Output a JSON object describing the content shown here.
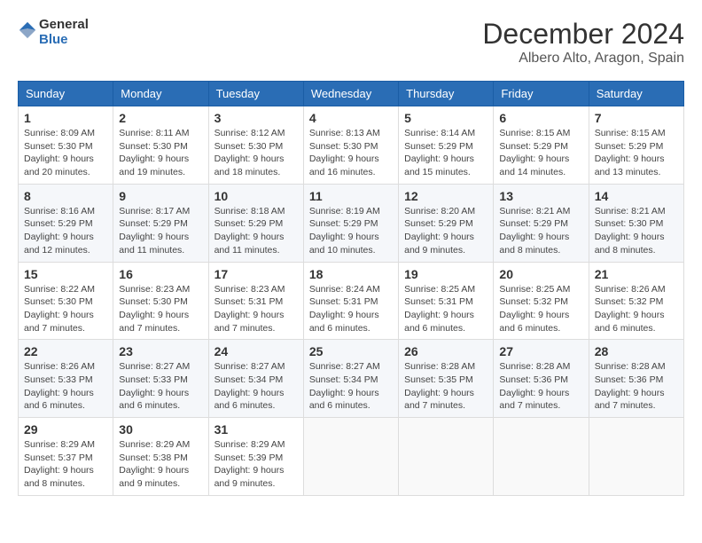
{
  "header": {
    "logo_general": "General",
    "logo_blue": "Blue",
    "month_title": "December 2024",
    "subtitle": "Albero Alto, Aragon, Spain"
  },
  "weekdays": [
    "Sunday",
    "Monday",
    "Tuesday",
    "Wednesday",
    "Thursday",
    "Friday",
    "Saturday"
  ],
  "weeks": [
    [
      {
        "day": "1",
        "info": "Sunrise: 8:09 AM\nSunset: 5:30 PM\nDaylight: 9 hours and 20 minutes."
      },
      {
        "day": "2",
        "info": "Sunrise: 8:11 AM\nSunset: 5:30 PM\nDaylight: 9 hours and 19 minutes."
      },
      {
        "day": "3",
        "info": "Sunrise: 8:12 AM\nSunset: 5:30 PM\nDaylight: 9 hours and 18 minutes."
      },
      {
        "day": "4",
        "info": "Sunrise: 8:13 AM\nSunset: 5:30 PM\nDaylight: 9 hours and 16 minutes."
      },
      {
        "day": "5",
        "info": "Sunrise: 8:14 AM\nSunset: 5:29 PM\nDaylight: 9 hours and 15 minutes."
      },
      {
        "day": "6",
        "info": "Sunrise: 8:15 AM\nSunset: 5:29 PM\nDaylight: 9 hours and 14 minutes."
      },
      {
        "day": "7",
        "info": "Sunrise: 8:15 AM\nSunset: 5:29 PM\nDaylight: 9 hours and 13 minutes."
      }
    ],
    [
      {
        "day": "8",
        "info": "Sunrise: 8:16 AM\nSunset: 5:29 PM\nDaylight: 9 hours and 12 minutes."
      },
      {
        "day": "9",
        "info": "Sunrise: 8:17 AM\nSunset: 5:29 PM\nDaylight: 9 hours and 11 minutes."
      },
      {
        "day": "10",
        "info": "Sunrise: 8:18 AM\nSunset: 5:29 PM\nDaylight: 9 hours and 11 minutes."
      },
      {
        "day": "11",
        "info": "Sunrise: 8:19 AM\nSunset: 5:29 PM\nDaylight: 9 hours and 10 minutes."
      },
      {
        "day": "12",
        "info": "Sunrise: 8:20 AM\nSunset: 5:29 PM\nDaylight: 9 hours and 9 minutes."
      },
      {
        "day": "13",
        "info": "Sunrise: 8:21 AM\nSunset: 5:29 PM\nDaylight: 9 hours and 8 minutes."
      },
      {
        "day": "14",
        "info": "Sunrise: 8:21 AM\nSunset: 5:30 PM\nDaylight: 9 hours and 8 minutes."
      }
    ],
    [
      {
        "day": "15",
        "info": "Sunrise: 8:22 AM\nSunset: 5:30 PM\nDaylight: 9 hours and 7 minutes."
      },
      {
        "day": "16",
        "info": "Sunrise: 8:23 AM\nSunset: 5:30 PM\nDaylight: 9 hours and 7 minutes."
      },
      {
        "day": "17",
        "info": "Sunrise: 8:23 AM\nSunset: 5:31 PM\nDaylight: 9 hours and 7 minutes."
      },
      {
        "day": "18",
        "info": "Sunrise: 8:24 AM\nSunset: 5:31 PM\nDaylight: 9 hours and 6 minutes."
      },
      {
        "day": "19",
        "info": "Sunrise: 8:25 AM\nSunset: 5:31 PM\nDaylight: 9 hours and 6 minutes."
      },
      {
        "day": "20",
        "info": "Sunrise: 8:25 AM\nSunset: 5:32 PM\nDaylight: 9 hours and 6 minutes."
      },
      {
        "day": "21",
        "info": "Sunrise: 8:26 AM\nSunset: 5:32 PM\nDaylight: 9 hours and 6 minutes."
      }
    ],
    [
      {
        "day": "22",
        "info": "Sunrise: 8:26 AM\nSunset: 5:33 PM\nDaylight: 9 hours and 6 minutes."
      },
      {
        "day": "23",
        "info": "Sunrise: 8:27 AM\nSunset: 5:33 PM\nDaylight: 9 hours and 6 minutes."
      },
      {
        "day": "24",
        "info": "Sunrise: 8:27 AM\nSunset: 5:34 PM\nDaylight: 9 hours and 6 minutes."
      },
      {
        "day": "25",
        "info": "Sunrise: 8:27 AM\nSunset: 5:34 PM\nDaylight: 9 hours and 6 minutes."
      },
      {
        "day": "26",
        "info": "Sunrise: 8:28 AM\nSunset: 5:35 PM\nDaylight: 9 hours and 7 minutes."
      },
      {
        "day": "27",
        "info": "Sunrise: 8:28 AM\nSunset: 5:36 PM\nDaylight: 9 hours and 7 minutes."
      },
      {
        "day": "28",
        "info": "Sunrise: 8:28 AM\nSunset: 5:36 PM\nDaylight: 9 hours and 7 minutes."
      }
    ],
    [
      {
        "day": "29",
        "info": "Sunrise: 8:29 AM\nSunset: 5:37 PM\nDaylight: 9 hours and 8 minutes."
      },
      {
        "day": "30",
        "info": "Sunrise: 8:29 AM\nSunset: 5:38 PM\nDaylight: 9 hours and 9 minutes."
      },
      {
        "day": "31",
        "info": "Sunrise: 8:29 AM\nSunset: 5:39 PM\nDaylight: 9 hours and 9 minutes."
      },
      null,
      null,
      null,
      null
    ]
  ],
  "colors": {
    "header_bg": "#2a6db5",
    "logo_blue": "#2a6db5"
  }
}
